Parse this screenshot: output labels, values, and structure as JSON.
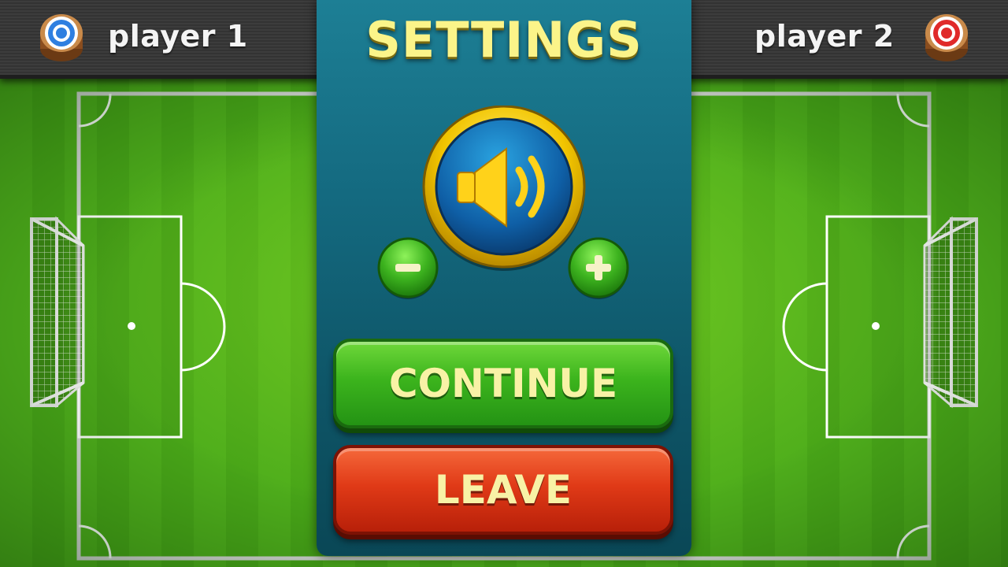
{
  "top_bar": {
    "player1": {
      "name": "player 1",
      "token_color": "#2f7fe0"
    },
    "player2": {
      "name": "player 2",
      "token_color": "#e02a2a"
    }
  },
  "settings_panel": {
    "title": "SETTINGS",
    "sound_icon": "speaker-icon",
    "volume_down_icon": "minus-icon",
    "volume_up_icon": "plus-icon",
    "continue_label": "CONTINUE",
    "leave_label": "LEAVE"
  },
  "colors": {
    "pitch_green": "#4fae1c",
    "panel_teal": "#146a80",
    "title_yellow": "#fbf489",
    "continue_green": "#3cb41d",
    "leave_red": "#e03a17",
    "sound_gold": "#f2c400"
  }
}
